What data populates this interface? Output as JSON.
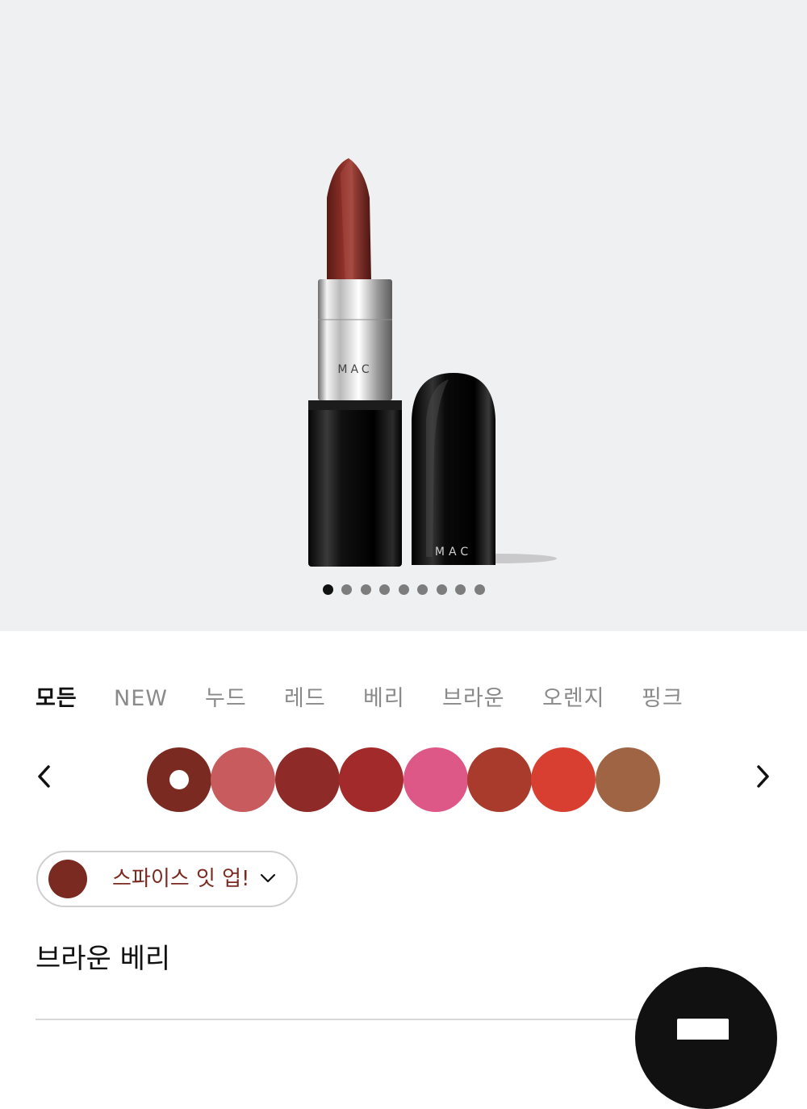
{
  "product_image": {
    "cap_brand": "MAC",
    "tube_brand": "MAC",
    "lipstick_color": "#7a2a24"
  },
  "carousel": {
    "total_images": 9,
    "active_index": 0
  },
  "filters": {
    "tabs": [
      "모든",
      "NEW",
      "누드",
      "레드",
      "베리",
      "브라운",
      "오렌지",
      "핑크"
    ],
    "active": "모든"
  },
  "swatches": {
    "colors": [
      "#7b2a21",
      "#c75b5e",
      "#8e2a27",
      "#a32a2a",
      "#dd5787",
      "#a83b2c",
      "#d93f31",
      "#9e6443"
    ],
    "selected_index": 0,
    "prev_icon": "chevron-left-icon",
    "next_icon": "chevron-right-icon"
  },
  "selected_shade": {
    "name": "스파이스 잇 업!",
    "color": "#7b2a21",
    "text_color": "#7b2a21",
    "dropdown_icon": "chevron-down-icon"
  },
  "shade_family": "브라운 베리",
  "fab": {
    "icon": "bag-icon"
  }
}
